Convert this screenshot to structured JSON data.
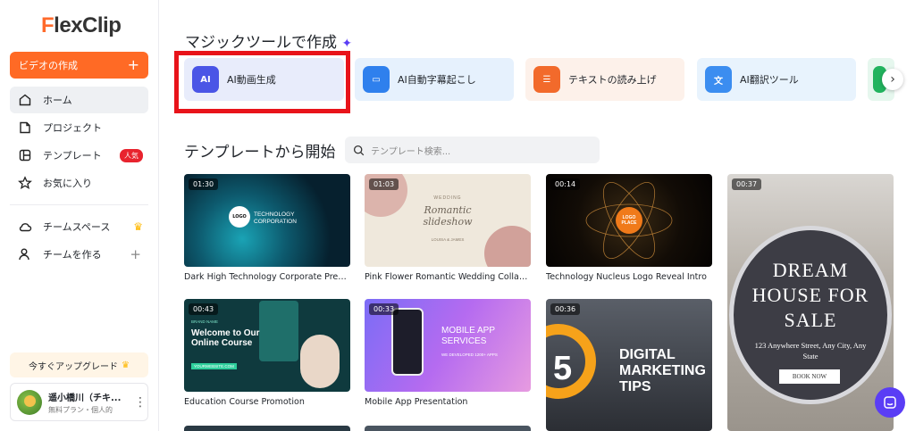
{
  "brand": {
    "logo_text_f": "F",
    "logo_text_rest": "lexClip",
    "accent_color": "#ff6a25"
  },
  "sidebar": {
    "create_label": "ビデオの作成",
    "create_plus": "+",
    "items": [
      {
        "label": "ホーム",
        "icon": "home-icon"
      },
      {
        "label": "プロジェクト",
        "icon": "folder-icon"
      },
      {
        "label": "テンプレート",
        "icon": "template-icon",
        "badge": "人気"
      },
      {
        "label": "お気に入り",
        "icon": "star-icon"
      },
      {
        "label": "チームスペース",
        "icon": "cloud-icon"
      },
      {
        "label": "チームを作る",
        "icon": "user-add-icon",
        "action": "+"
      }
    ],
    "upgrade_label": "今すぐアップグレード",
    "account": {
      "name": "遥小橋川（チキ...",
      "plan": "無料プラン・個人的"
    }
  },
  "magic": {
    "title": "マジックツールで作成",
    "tools": [
      {
        "label": "AI動画生成",
        "icon": "ai-video-icon"
      },
      {
        "label": "AI自動字幕起こし",
        "icon": "subtitle-icon"
      },
      {
        "label": "テキストの読み上げ",
        "icon": "text-speech-icon"
      },
      {
        "label": "AI翻訳ツール",
        "icon": "translate-icon"
      }
    ]
  },
  "templates": {
    "title": "テンプレートから開始",
    "search_placeholder": "テンプレート検索...",
    "items": [
      {
        "name": "Dark High Technology Corporate Presen...",
        "duration": "01:30",
        "overlay": "TECHNOLOGY CORPORATION"
      },
      {
        "name": "Pink Flower Romantic Wedding Collage ...",
        "duration": "01:03",
        "overlay_top": "WEDDING",
        "overlay": "Romantic slideshow",
        "overlay_small": "LOUISA & JAMES"
      },
      {
        "name": "Technology Nucleus Logo Reveal Intro",
        "duration": "00:14",
        "overlay": "LOGO PLACE"
      },
      {
        "name": "",
        "duration": "00:37",
        "overlay": "DREAM HOUSE FOR SALE",
        "overlay_small": "123 Anywhere Street, Any City, Any State",
        "overlay_button": "BOOK NOW"
      },
      {
        "name": "Education Course Promotion",
        "duration": "00:43",
        "overlay_top": "BRAND NAME",
        "overlay": "Welcome to Our Online Course",
        "overlay_small": "YOURWEBSITE.COM"
      },
      {
        "name": "Mobile App Presentation",
        "duration": "00:33",
        "overlay": "MOBILE APP SERVICES",
        "overlay_small": "WE DEVELOPED 1200+ APPS"
      },
      {
        "name": "",
        "duration": "00:36",
        "overlay_big": "5",
        "overlay": "DIGITAL MARKETING TIPS"
      }
    ]
  }
}
